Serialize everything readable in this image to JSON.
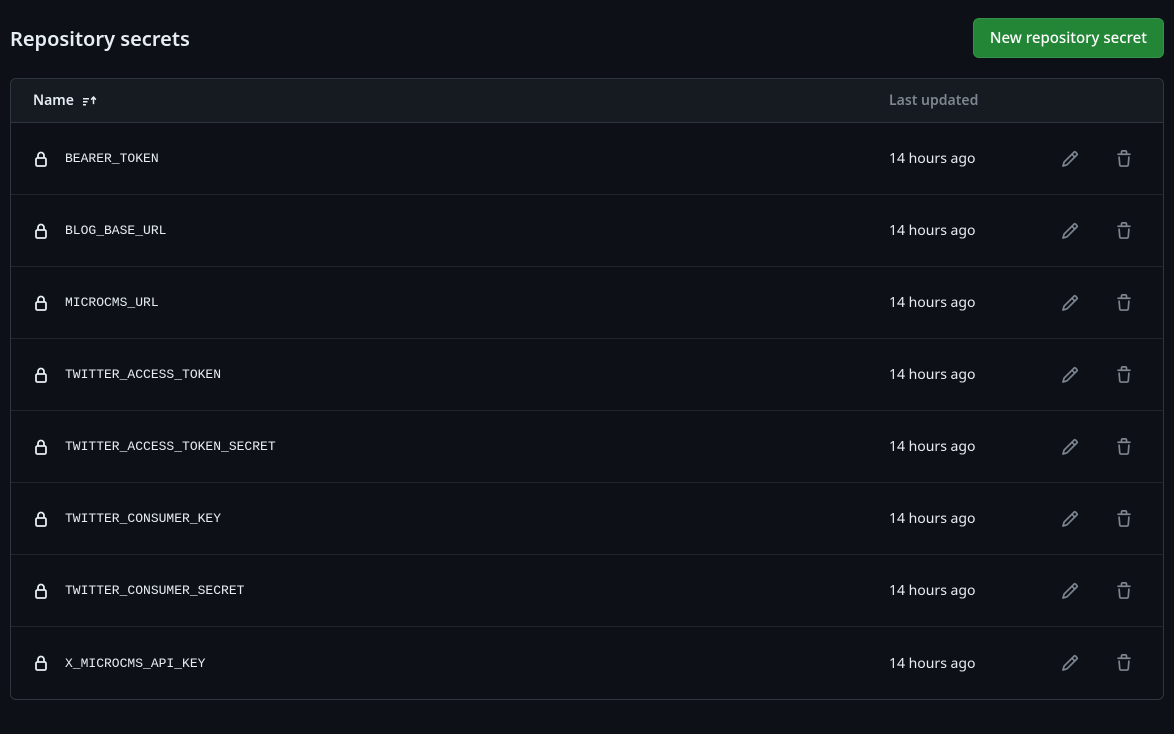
{
  "header": {
    "title": "Repository secrets",
    "new_button": "New repository secret"
  },
  "table": {
    "columns": {
      "name": "Name",
      "last_updated": "Last updated"
    },
    "rows": [
      {
        "name": "BEARER_TOKEN",
        "updated": "14 hours ago"
      },
      {
        "name": "BLOG_BASE_URL",
        "updated": "14 hours ago"
      },
      {
        "name": "MICROCMS_URL",
        "updated": "14 hours ago"
      },
      {
        "name": "TWITTER_ACCESS_TOKEN",
        "updated": "14 hours ago"
      },
      {
        "name": "TWITTER_ACCESS_TOKEN_SECRET",
        "updated": "14 hours ago"
      },
      {
        "name": "TWITTER_CONSUMER_KEY",
        "updated": "14 hours ago"
      },
      {
        "name": "TWITTER_CONSUMER_SECRET",
        "updated": "14 hours ago"
      },
      {
        "name": "X_MICROCMS_API_KEY",
        "updated": "14 hours ago"
      }
    ]
  }
}
